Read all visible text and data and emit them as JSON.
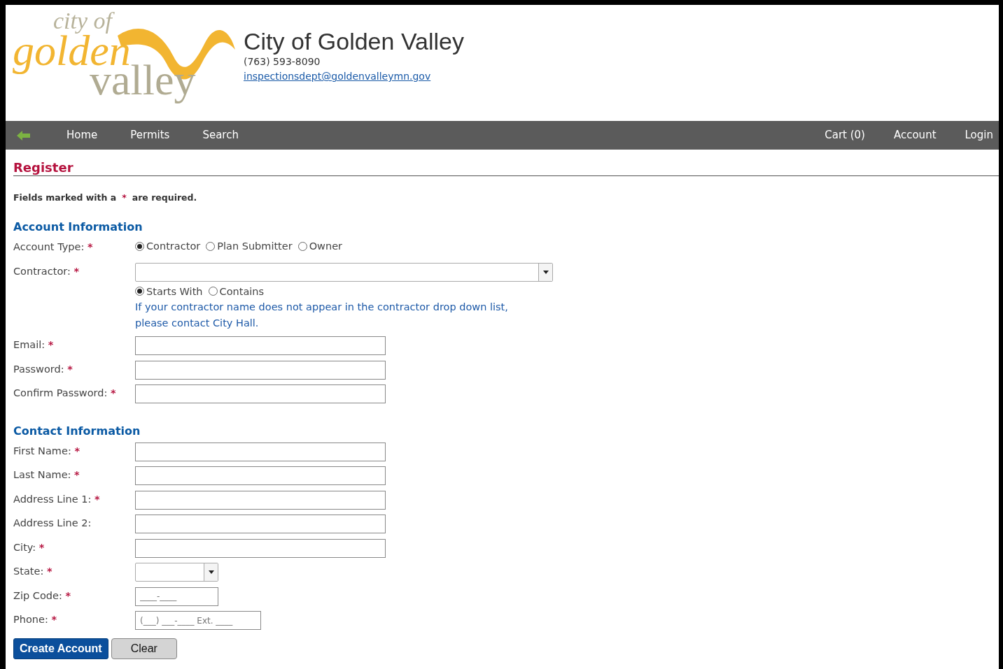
{
  "header": {
    "logo": {
      "line_1": "city of",
      "line_2": "golden",
      "line_3": "valley"
    },
    "title": "City of Golden Valley",
    "phone": "(763) 593-8090",
    "email": "inspectionsdept@goldenvalleymn.gov"
  },
  "nav": {
    "left": [
      "Home",
      "Permits",
      "Search"
    ],
    "right": [
      "Cart (0)",
      "Account",
      "Login"
    ]
  },
  "page_title": "Register",
  "required_note": {
    "before": "Fields marked with a",
    "mark": "*",
    "after": "are required."
  },
  "sections": [
    {
      "title": "Account Information",
      "fields": [
        {
          "kind": "radio",
          "label": "Account Type:",
          "required_mark": "*",
          "options": [
            {
              "label": "Contractor",
              "selected": true
            },
            {
              "label": "Plan Submitter",
              "selected": false
            },
            {
              "label": "Owner",
              "selected": false
            }
          ]
        },
        {
          "kind": "combo",
          "label": "Contractor:",
          "required_mark": "*",
          "options": [
            {
              "label": "Starts With",
              "selected": true
            },
            {
              "label": "Contains",
              "selected": false
            }
          ],
          "help": "If your contractor name does not appear in the contractor drop down list, please contact City Hall."
        },
        {
          "kind": "text",
          "label": "Email:",
          "required_mark": "*"
        },
        {
          "kind": "text",
          "label": "Password:",
          "required_mark": "*"
        },
        {
          "kind": "text",
          "label": "Confirm Password:",
          "required_mark": "*"
        }
      ]
    },
    {
      "title": "Contact Information",
      "fields": [
        {
          "kind": "text",
          "label": "First Name:",
          "required_mark": "*"
        },
        {
          "kind": "text",
          "label": "Last Name:",
          "required_mark": "*"
        },
        {
          "kind": "text",
          "label": "Address Line 1:",
          "required_mark": "*"
        },
        {
          "kind": "text",
          "label": "Address Line 2:"
        },
        {
          "kind": "text",
          "label": "City:",
          "required_mark": "*"
        },
        {
          "kind": "select",
          "label": "State:",
          "required_mark": "*"
        },
        {
          "kind": "zip",
          "label": "Zip Code:",
          "required_mark": "*",
          "placeholder": "____-____"
        },
        {
          "kind": "phone",
          "label": "Phone:",
          "required_mark": "*",
          "placeholder": "(___) ___-____ Ext. ____"
        }
      ]
    }
  ],
  "buttons": [
    {
      "label": "Create Account",
      "kind": "primary"
    },
    {
      "label": "Clear",
      "kind": "secondary"
    }
  ]
}
